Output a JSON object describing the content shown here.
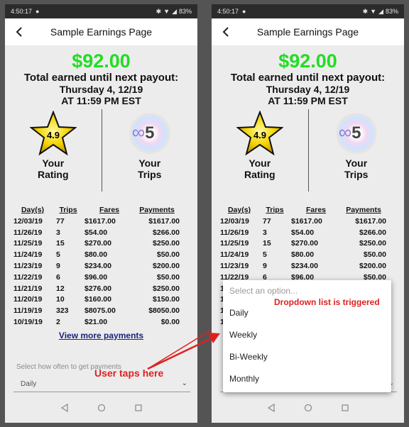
{
  "status": {
    "time": "4:50:17",
    "battery": "83%"
  },
  "header": {
    "title": "Sample Earnings Page"
  },
  "earnings": {
    "amount": "$92.00",
    "line1": "Total earned until next payout:",
    "line2": "Thursday 4, 12/19",
    "line3": "AT 11:59 PM EST"
  },
  "rating": {
    "value": "4.9",
    "label_line1": "Your",
    "label_line2": "Rating"
  },
  "trips": {
    "value": "5",
    "label_line1": "Your",
    "label_line2": "Trips"
  },
  "table": {
    "headers": [
      "Day(s)",
      "Trips",
      "Fares",
      "Payments"
    ],
    "rows": [
      [
        "12/03/19",
        "77",
        "$1617.00",
        "$1617.00"
      ],
      [
        "11/26/19",
        "3",
        "$54.00",
        "$266.00"
      ],
      [
        "11/25/19",
        "15",
        "$270.00",
        "$250.00"
      ],
      [
        "11/24/19",
        "5",
        "$80.00",
        "$50.00"
      ],
      [
        "11/23/19",
        "9",
        "$234.00",
        "$200.00"
      ],
      [
        "11/22/19",
        "6",
        "$96.00",
        "$50.00"
      ],
      [
        "11/21/19",
        "12",
        "$276.00",
        "$250.00"
      ],
      [
        "11/20/19",
        "10",
        "$160.00",
        "$150.00"
      ],
      [
        "11/19/19",
        "323",
        "$8075.00",
        "$8050.00"
      ],
      [
        "10/19/19",
        "2",
        "$21.00",
        "$0.00"
      ]
    ]
  },
  "view_more": "View more payments",
  "payment_select": {
    "label": "Select how often to get payments",
    "value": "Daily"
  },
  "dropdown": {
    "placeholder": "Select an option...",
    "options": [
      "Daily",
      "Weekly",
      "Bi-Weekly",
      "Monthly"
    ]
  },
  "annotations": {
    "tap": "User taps here",
    "dropdown": "Dropdown list is triggered",
    "color": "#e02020"
  },
  "colors": {
    "amount": "#22dd22",
    "link": "#1a237e",
    "status_bar": "#2b2b2b"
  }
}
